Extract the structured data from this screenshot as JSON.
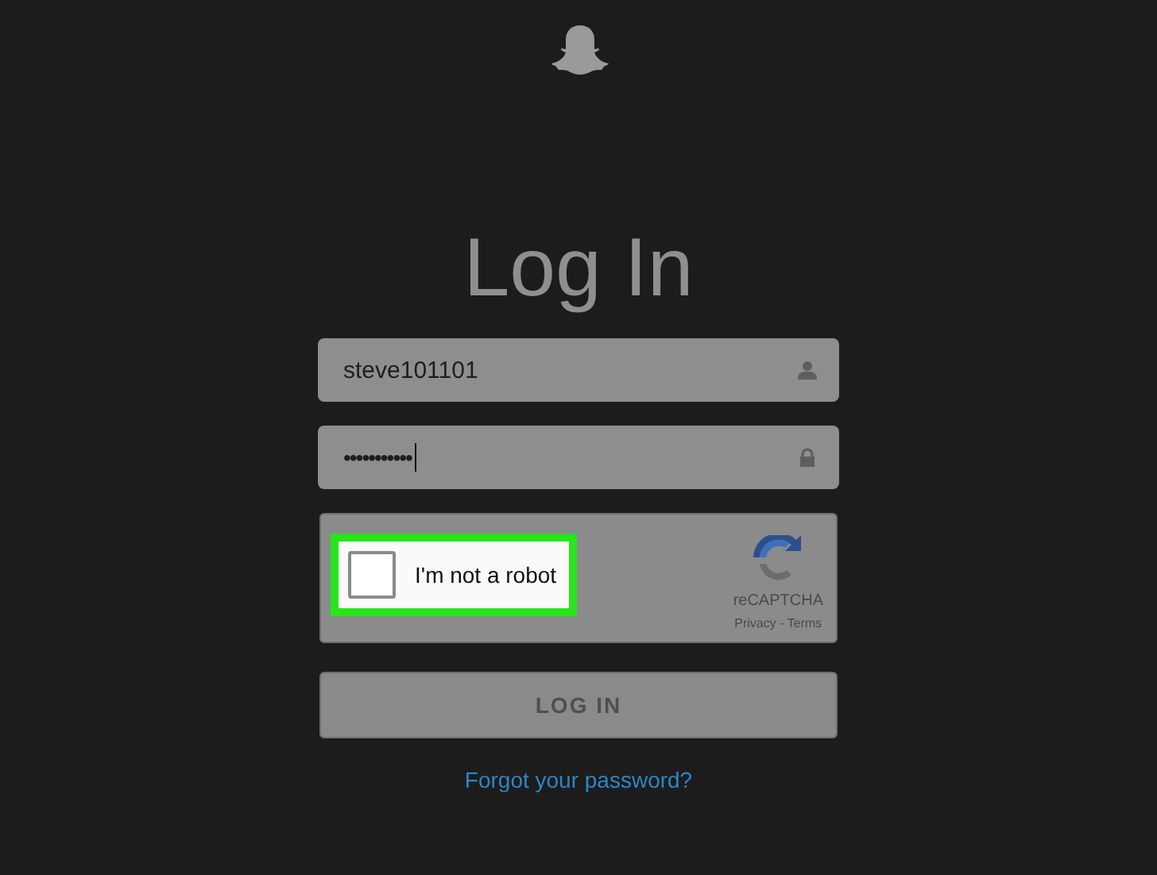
{
  "title": "Log In",
  "username": {
    "value": "steve101101"
  },
  "password": {
    "value": "•••••••••••",
    "focused": true
  },
  "captcha": {
    "label": "I'm not a robot",
    "checked": false,
    "highlighted": true,
    "brand": "reCAPTCHA",
    "privacy": "Privacy",
    "separator": "-",
    "terms": "Terms"
  },
  "login_button": {
    "label": "LOG IN",
    "disabled": true
  },
  "forgot_link": "Forgot your password?"
}
